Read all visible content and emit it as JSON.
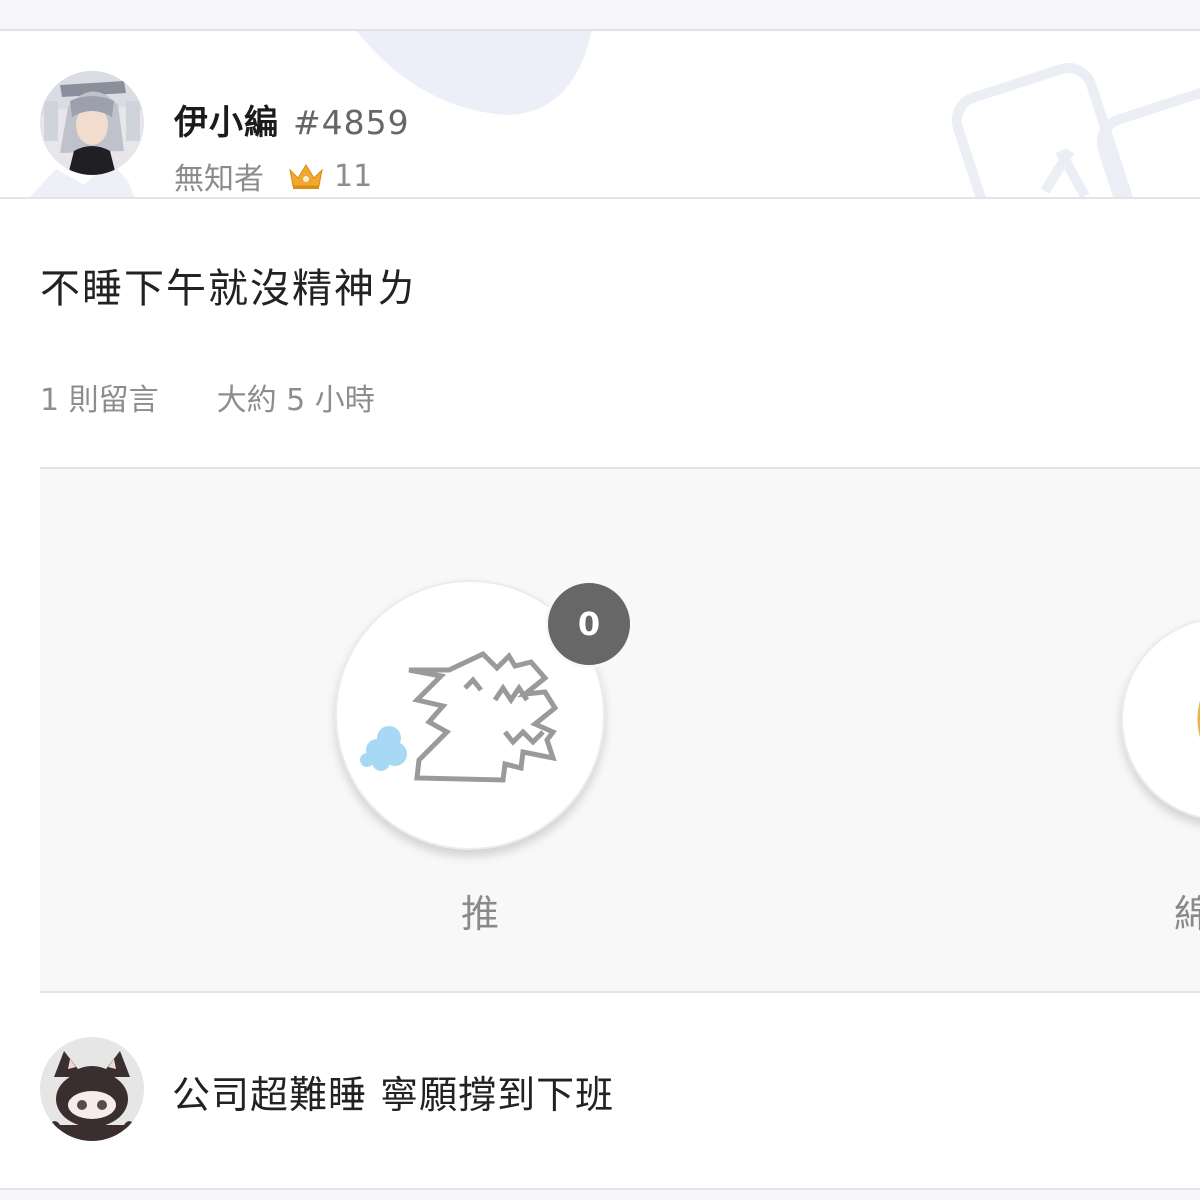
{
  "author": {
    "name": "伊小編",
    "uid": "#4859",
    "title": "無知者",
    "level": "11"
  },
  "post": {
    "title": "不睡下午就沒精神ㄌ",
    "comment_count": "1 則留言",
    "time_ago": "大約 5 小時"
  },
  "reactions": [
    {
      "label": "推",
      "count": "0",
      "icon": "dragon-push-icon"
    },
    {
      "label": "綿",
      "icon": "reaction-icon"
    }
  ],
  "comment": {
    "text": "公司超難睡 寧願撐到下班"
  },
  "colors": {
    "background": "#ffffff",
    "panel": "#f8f8f8",
    "badge": "#676767",
    "crown": "#f0a830",
    "header_deco": "#e9ebf6"
  }
}
